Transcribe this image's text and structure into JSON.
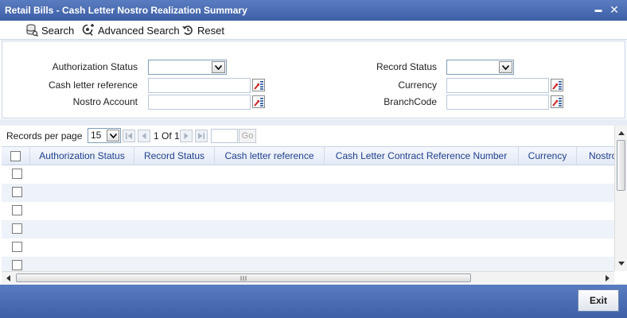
{
  "window": {
    "title": "Retail Bills - Cash Letter Nostro Realization Summary",
    "minimize_glyph": "▬",
    "close_glyph": "✕"
  },
  "toolbar": {
    "search_label": "Search",
    "advanced_search_label": "Advanced Search",
    "reset_label": "Reset"
  },
  "criteria": {
    "authorization_status": {
      "label": "Authorization Status",
      "value": ""
    },
    "record_status": {
      "label": "Record Status",
      "value": ""
    },
    "cash_letter_reference": {
      "label": "Cash letter reference",
      "value": ""
    },
    "currency": {
      "label": "Currency",
      "value": ""
    },
    "nostro_account": {
      "label": "Nostro Account",
      "value": ""
    },
    "branch_code": {
      "label": "BranchCode",
      "value": ""
    }
  },
  "pager": {
    "records_per_page_label": "Records per page",
    "records_per_page_value": "15",
    "page_text": "1 Of 1",
    "go_label": "Go",
    "page_input": ""
  },
  "grid": {
    "columns": [
      "Authorization Status",
      "Record Status",
      "Cash letter reference",
      "Cash Letter Contract Reference Number",
      "Currency",
      "Nostro"
    ],
    "rows": [
      {},
      {},
      {},
      {},
      {},
      {}
    ]
  },
  "footer": {
    "exit_label": "Exit"
  },
  "colors": {
    "titlebar": "#3d5fa6",
    "header_text": "#1f3f8f",
    "alt_row": "#eef2f9"
  }
}
